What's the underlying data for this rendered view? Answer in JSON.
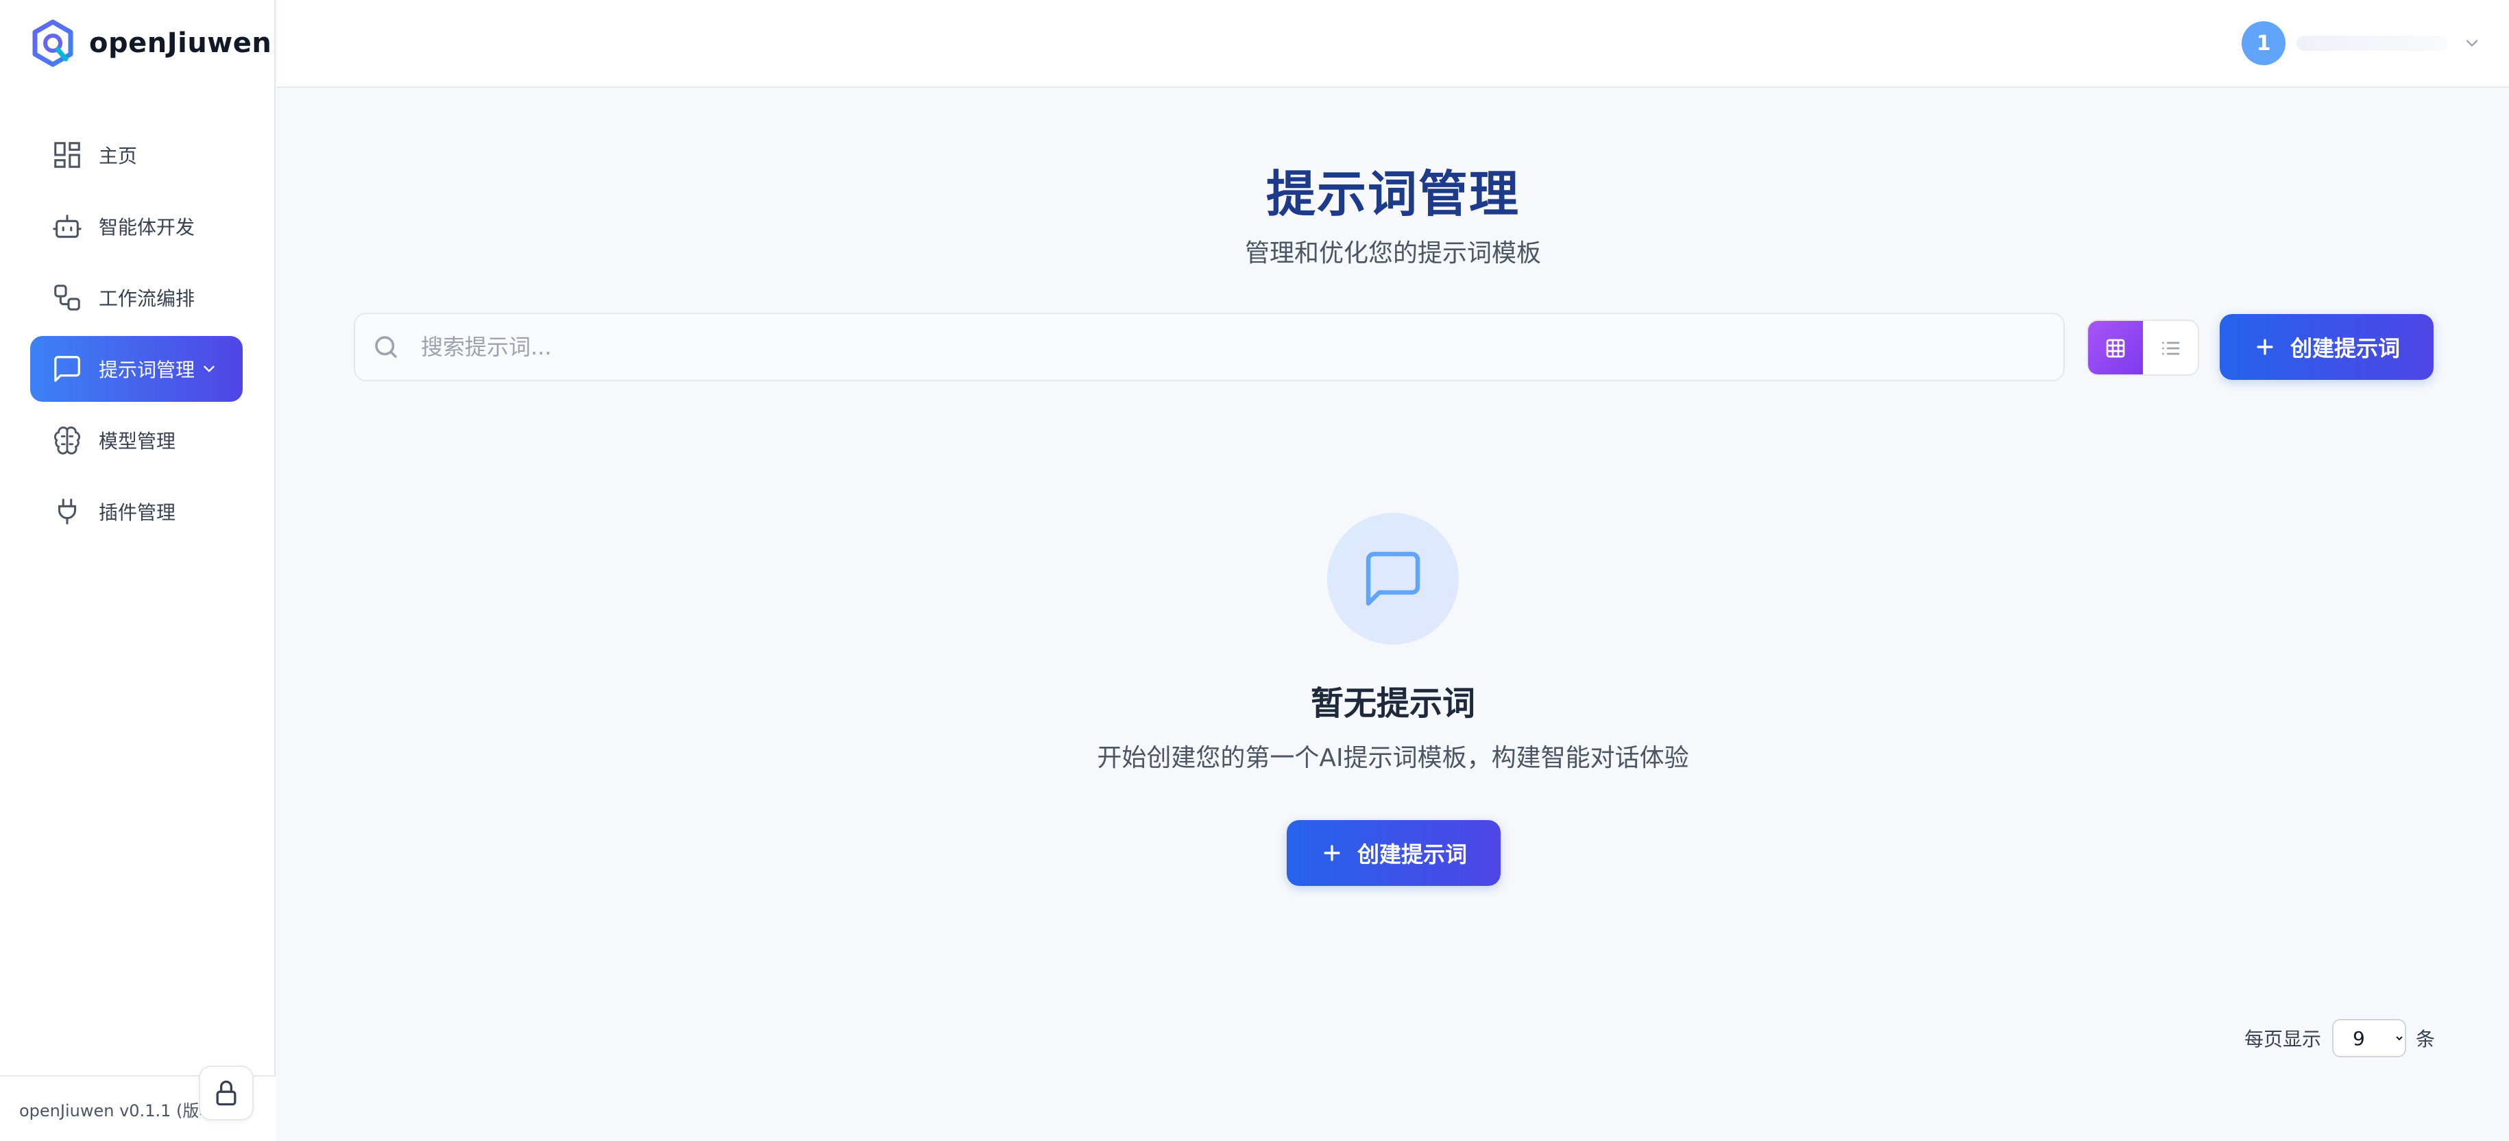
{
  "brand": {
    "name": "openJiuwen",
    "logo_icon": "openjiuwen-logo-icon"
  },
  "sidebar": {
    "items": [
      {
        "label": "主页",
        "icon": "dashboard-grid-icon",
        "active": false
      },
      {
        "label": "智能体开发",
        "icon": "robot-icon",
        "active": false
      },
      {
        "label": "工作流编排",
        "icon": "workflow-icon",
        "active": false
      },
      {
        "label": "提示词管理",
        "icon": "chat-bubble-icon",
        "active": true
      },
      {
        "label": "模型管理",
        "icon": "brain-icon",
        "active": false
      },
      {
        "label": "插件管理",
        "icon": "plug-icon",
        "active": false
      }
    ],
    "footer": {
      "version": "openJiuwen v0.1.1 (版本"
    }
  },
  "header": {
    "user": {
      "avatar_text": "1"
    }
  },
  "main": {
    "title": "提示词管理",
    "subtitle": "管理和优化您的提示词模板",
    "search": {
      "placeholder": "搜索提示词...",
      "value": ""
    },
    "create_label": "创建提示词",
    "empty": {
      "title": "暂无提示词",
      "description": "开始创建您的第一个AI提示词模板，构建智能对话体验",
      "create_label": "创建提示词"
    },
    "pagination": {
      "prefix": "每页显示",
      "page_size": "9",
      "options": [
        "9"
      ],
      "suffix": "条"
    }
  },
  "colors": {
    "primary": "#2563eb",
    "primary_end": "#4f46e5",
    "title": "#1e3a8a",
    "toggle_active": "#7c3aed",
    "background": "#f6f8fb"
  }
}
